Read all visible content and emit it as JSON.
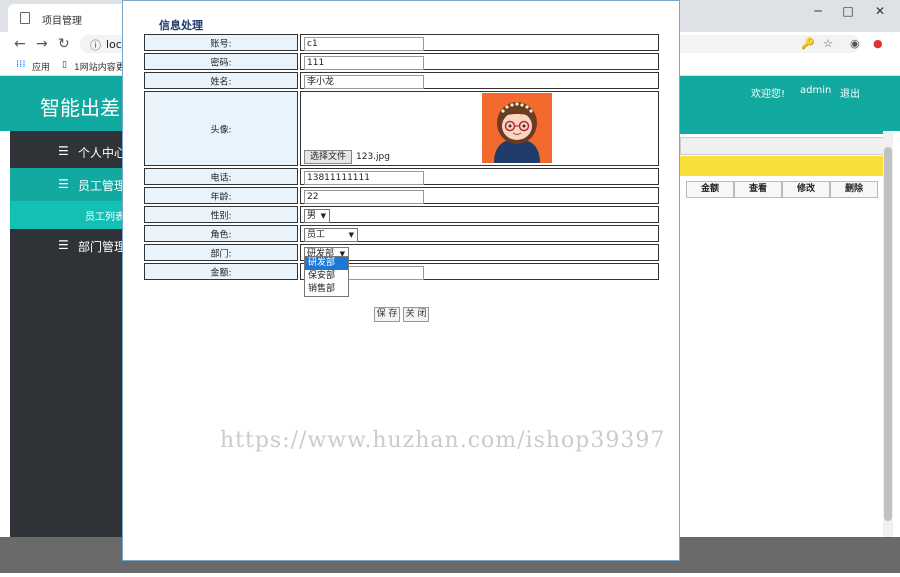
{
  "browser": {
    "tab_title": "项目管理",
    "url": "loca",
    "bookmarks": [
      "应用",
      "1网站内容更"
    ],
    "win_min": "─",
    "win_max": "□",
    "win_close": "✕",
    "nav_back": "←",
    "nav_fwd": "→",
    "nav_reload": "↻",
    "info_icon": "ⓘ",
    "key_icon": "🔑",
    "star_icon": "☆",
    "account_icon": "◉",
    "update_icon": "●"
  },
  "app": {
    "title": "智能出差",
    "welcome": "欢迎您!",
    "user": "admin",
    "logout": "退出",
    "sidebar": [
      {
        "label": "个人中心"
      },
      {
        "label": "员工管理"
      },
      {
        "label": "员工列表"
      },
      {
        "label": "部门管理"
      }
    ],
    "table_headers": [
      "金额",
      "查看",
      "修改",
      "删除"
    ],
    "accent": "#11a9a0"
  },
  "modal": {
    "title": "信息处理",
    "fields": {
      "account": {
        "label": "账号:",
        "value": "c1"
      },
      "password": {
        "label": "密码:",
        "value": "111"
      },
      "name": {
        "label": "姓名:",
        "value": "李小龙"
      },
      "avatar": {
        "label": "头像:",
        "file_button": "选择文件",
        "file_name": "123.jpg"
      },
      "phone": {
        "label": "电话:",
        "value": "13811111111"
      },
      "age": {
        "label": "年龄:",
        "value": "22"
      },
      "gender": {
        "label": "性别:",
        "value": "男"
      },
      "role": {
        "label": "角色:",
        "value": "员工"
      },
      "dept": {
        "label": "部门:",
        "value": "研发部",
        "options": [
          "研发部",
          "保安部",
          "销售部"
        ]
      },
      "amount": {
        "label": "金额:",
        "value": ""
      }
    },
    "save": "保 存",
    "close": "关 闭"
  },
  "watermark": "https://www.huzhan.com/ishop39397"
}
